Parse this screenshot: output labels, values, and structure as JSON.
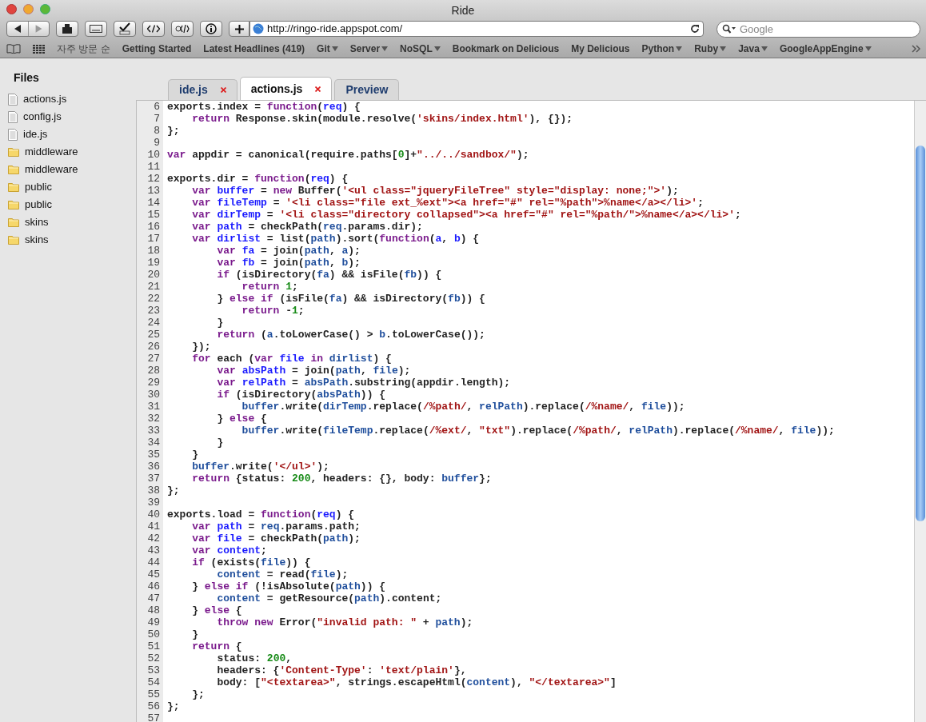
{
  "window": {
    "title": "Ride"
  },
  "toolbar": {
    "url": "http://ringo-ride.appspot.com/",
    "search": {
      "placeholder": "Google"
    }
  },
  "bookmarks": [
    {
      "label": "자주 방문 순",
      "menu": false
    },
    {
      "label": "Getting Started",
      "menu": false
    },
    {
      "label": "Latest Headlines (419)",
      "menu": false
    },
    {
      "label": "Git",
      "menu": true
    },
    {
      "label": "Server",
      "menu": true
    },
    {
      "label": "NoSQL",
      "menu": true
    },
    {
      "label": "Bookmark on Delicious",
      "menu": false
    },
    {
      "label": "My Delicious",
      "menu": false
    },
    {
      "label": "Python",
      "menu": true
    },
    {
      "label": "Ruby",
      "menu": true
    },
    {
      "label": "Java",
      "menu": true
    },
    {
      "label": "GoogleAppEngine",
      "menu": true
    }
  ],
  "sidebar": {
    "title": "Files",
    "items": [
      {
        "label": "actions.js",
        "kind": "file"
      },
      {
        "label": "config.js",
        "kind": "file"
      },
      {
        "label": "ide.js",
        "kind": "file"
      },
      {
        "label": "middleware",
        "kind": "folder"
      },
      {
        "label": "middleware",
        "kind": "folder"
      },
      {
        "label": "public",
        "kind": "folder"
      },
      {
        "label": "public",
        "kind": "folder"
      },
      {
        "label": "skins",
        "kind": "folder"
      },
      {
        "label": "skins",
        "kind": "folder"
      }
    ]
  },
  "tabs": [
    {
      "label": "ide.js",
      "closable": true,
      "selected": false
    },
    {
      "label": "actions.js",
      "closable": true,
      "selected": true
    },
    {
      "label": "Preview",
      "closable": false,
      "selected": false
    }
  ],
  "editor": {
    "lines": [
      {
        "n": "6",
        "tokens": [
          {
            "kind": "p",
            "text": "exports.index = "
          },
          {
            "kind": "k",
            "text": "function"
          },
          {
            "kind": "p",
            "text": "("
          },
          {
            "kind": "d",
            "text": "req"
          },
          {
            "kind": "p",
            "text": ") {"
          }
        ]
      },
      {
        "n": "7",
        "tokens": [
          {
            "kind": "k",
            "text": "    return"
          },
          {
            "kind": "p",
            "text": " Response.skin(module.resolve("
          },
          {
            "kind": "s",
            "text": "'skins/index.html'"
          },
          {
            "kind": "p",
            "text": "), {});"
          }
        ]
      },
      {
        "n": "8",
        "tokens": [
          {
            "kind": "p",
            "text": "};"
          }
        ]
      },
      {
        "n": "9"
      },
      {
        "n": "10",
        "tokens": [
          {
            "kind": "k",
            "text": "var"
          },
          {
            "kind": "p",
            "text": " appdir = canonical(require.paths["
          },
          {
            "kind": "n",
            "text": "0"
          },
          {
            "kind": "p",
            "text": "]+"
          },
          {
            "kind": "s",
            "text": "\"../../sandbox/\""
          },
          {
            "kind": "p",
            "text": ");"
          }
        ]
      },
      {
        "n": "11"
      },
      {
        "n": "12",
        "tokens": [
          {
            "kind": "p",
            "text": "exports.dir = "
          },
          {
            "kind": "k",
            "text": "function"
          },
          {
            "kind": "p",
            "text": "("
          },
          {
            "kind": "d",
            "text": "req"
          },
          {
            "kind": "p",
            "text": ") {"
          }
        ]
      },
      {
        "n": "13",
        "tokens": [
          {
            "kind": "k",
            "text": "    var"
          },
          {
            "kind": "d",
            "text": " buffer"
          },
          {
            "kind": "p",
            "text": " = "
          },
          {
            "kind": "k",
            "text": "new"
          },
          {
            "kind": "p",
            "text": " Buffer("
          },
          {
            "kind": "s",
            "text": "'<ul class=\"jqueryFileTree\" style=\"display: none;\">'"
          },
          {
            "kind": "p",
            "text": ");"
          }
        ]
      },
      {
        "n": "14",
        "tokens": [
          {
            "kind": "k",
            "text": "    var"
          },
          {
            "kind": "d",
            "text": " fileTemp"
          },
          {
            "kind": "p",
            "text": " = "
          },
          {
            "kind": "s",
            "text": "'<li class=\"file ext_%ext\"><a href=\"#\" rel=\"%path\">%name</a></li>'"
          },
          {
            "kind": "p",
            "text": ";"
          }
        ]
      },
      {
        "n": "15",
        "tokens": [
          {
            "kind": "k",
            "text": "    var"
          },
          {
            "kind": "d",
            "text": " dirTemp"
          },
          {
            "kind": "p",
            "text": " = "
          },
          {
            "kind": "s",
            "text": "'<li class=\"directory collapsed\"><a href=\"#\" rel=\"%path/\">%name</a></li>'"
          },
          {
            "kind": "p",
            "text": ";"
          }
        ]
      },
      {
        "n": "16",
        "tokens": [
          {
            "kind": "k",
            "text": "    var"
          },
          {
            "kind": "d",
            "text": " path"
          },
          {
            "kind": "p",
            "text": " = checkPath("
          },
          {
            "kind": "v",
            "text": "req"
          },
          {
            "kind": "p",
            "text": ".params.dir);"
          }
        ]
      },
      {
        "n": "17",
        "tokens": [
          {
            "kind": "k",
            "text": "    var"
          },
          {
            "kind": "d",
            "text": " dirlist"
          },
          {
            "kind": "p",
            "text": " = list("
          },
          {
            "kind": "v",
            "text": "path"
          },
          {
            "kind": "p",
            "text": ").sort("
          },
          {
            "kind": "k",
            "text": "function"
          },
          {
            "kind": "p",
            "text": "("
          },
          {
            "kind": "d",
            "text": "a"
          },
          {
            "kind": "p",
            "text": ", "
          },
          {
            "kind": "d",
            "text": "b"
          },
          {
            "kind": "p",
            "text": ") {"
          }
        ]
      },
      {
        "n": "18",
        "tokens": [
          {
            "kind": "k",
            "text": "        var"
          },
          {
            "kind": "d",
            "text": " fa"
          },
          {
            "kind": "p",
            "text": " = join("
          },
          {
            "kind": "v",
            "text": "path"
          },
          {
            "kind": "p",
            "text": ", "
          },
          {
            "kind": "v",
            "text": "a"
          },
          {
            "kind": "p",
            "text": ");"
          }
        ]
      },
      {
        "n": "19",
        "tokens": [
          {
            "kind": "k",
            "text": "        var"
          },
          {
            "kind": "d",
            "text": " fb"
          },
          {
            "kind": "p",
            "text": " = join("
          },
          {
            "kind": "v",
            "text": "path"
          },
          {
            "kind": "p",
            "text": ", "
          },
          {
            "kind": "v",
            "text": "b"
          },
          {
            "kind": "p",
            "text": ");"
          }
        ]
      },
      {
        "n": "20",
        "tokens": [
          {
            "kind": "k",
            "text": "        if"
          },
          {
            "kind": "p",
            "text": " (isDirectory("
          },
          {
            "kind": "v",
            "text": "fa"
          },
          {
            "kind": "p",
            "text": ") && isFile("
          },
          {
            "kind": "v",
            "text": "fb"
          },
          {
            "kind": "p",
            "text": ")) {"
          }
        ]
      },
      {
        "n": "21",
        "tokens": [
          {
            "kind": "k",
            "text": "            return"
          },
          {
            "kind": "n",
            "text": " 1"
          },
          {
            "kind": "p",
            "text": ";"
          }
        ]
      },
      {
        "n": "22",
        "tokens": [
          {
            "kind": "p",
            "text": "        } "
          },
          {
            "kind": "k",
            "text": "else if"
          },
          {
            "kind": "p",
            "text": " (isFile("
          },
          {
            "kind": "v",
            "text": "fa"
          },
          {
            "kind": "p",
            "text": ") && isDirectory("
          },
          {
            "kind": "v",
            "text": "fb"
          },
          {
            "kind": "p",
            "text": ")) {"
          }
        ]
      },
      {
        "n": "23",
        "tokens": [
          {
            "kind": "k",
            "text": "            return"
          },
          {
            "kind": "p",
            "text": " -"
          },
          {
            "kind": "n",
            "text": "1"
          },
          {
            "kind": "p",
            "text": ";"
          }
        ]
      },
      {
        "n": "24",
        "tokens": [
          {
            "kind": "p",
            "text": "        }"
          }
        ]
      },
      {
        "n": "25",
        "tokens": [
          {
            "kind": "k",
            "text": "        return"
          },
          {
            "kind": "p",
            "text": " ("
          },
          {
            "kind": "v",
            "text": "a"
          },
          {
            "kind": "p",
            "text": ".toLowerCase() > "
          },
          {
            "kind": "v",
            "text": "b"
          },
          {
            "kind": "p",
            "text": ".toLowerCase());"
          }
        ]
      },
      {
        "n": "26",
        "tokens": [
          {
            "kind": "p",
            "text": "    });"
          }
        ]
      },
      {
        "n": "27",
        "tokens": [
          {
            "kind": "k",
            "text": "    for"
          },
          {
            "kind": "p",
            "text": " each ("
          },
          {
            "kind": "k",
            "text": "var"
          },
          {
            "kind": "d",
            "text": " file"
          },
          {
            "kind": "k",
            "text": " in"
          },
          {
            "kind": "v",
            "text": " dirlist"
          },
          {
            "kind": "p",
            "text": ") {"
          }
        ]
      },
      {
        "n": "28",
        "tokens": [
          {
            "kind": "k",
            "text": "        var"
          },
          {
            "kind": "d",
            "text": " absPath"
          },
          {
            "kind": "p",
            "text": " = join("
          },
          {
            "kind": "v",
            "text": "path"
          },
          {
            "kind": "p",
            "text": ", "
          },
          {
            "kind": "v",
            "text": "file"
          },
          {
            "kind": "p",
            "text": ");"
          }
        ]
      },
      {
        "n": "29",
        "tokens": [
          {
            "kind": "k",
            "text": "        var"
          },
          {
            "kind": "d",
            "text": " relPath"
          },
          {
            "kind": "p",
            "text": " = "
          },
          {
            "kind": "v",
            "text": "absPath"
          },
          {
            "kind": "p",
            "text": ".substring(appdir.length);"
          }
        ]
      },
      {
        "n": "30",
        "tokens": [
          {
            "kind": "k",
            "text": "        if"
          },
          {
            "kind": "p",
            "text": " (isDirectory("
          },
          {
            "kind": "v",
            "text": "absPath"
          },
          {
            "kind": "p",
            "text": ")) {"
          }
        ]
      },
      {
        "n": "31",
        "tokens": [
          {
            "kind": "v",
            "text": "            buffer"
          },
          {
            "kind": "p",
            "text": ".write("
          },
          {
            "kind": "v",
            "text": "dirTemp"
          },
          {
            "kind": "p",
            "text": ".replace("
          },
          {
            "kind": "s",
            "text": "/%path/"
          },
          {
            "kind": "p",
            "text": ", "
          },
          {
            "kind": "v",
            "text": "relPath"
          },
          {
            "kind": "p",
            "text": ").replace("
          },
          {
            "kind": "s",
            "text": "/%name/"
          },
          {
            "kind": "p",
            "text": ", "
          },
          {
            "kind": "v",
            "text": "file"
          },
          {
            "kind": "p",
            "text": "));"
          }
        ]
      },
      {
        "n": "32",
        "tokens": [
          {
            "kind": "p",
            "text": "        } "
          },
          {
            "kind": "k",
            "text": "else"
          },
          {
            "kind": "p",
            "text": " {"
          }
        ]
      },
      {
        "n": "33",
        "tokens": [
          {
            "kind": "v",
            "text": "            buffer"
          },
          {
            "kind": "p",
            "text": ".write("
          },
          {
            "kind": "v",
            "text": "fileTemp"
          },
          {
            "kind": "p",
            "text": ".replace("
          },
          {
            "kind": "s",
            "text": "/%ext/"
          },
          {
            "kind": "p",
            "text": ", "
          },
          {
            "kind": "s",
            "text": "\"txt\""
          },
          {
            "kind": "p",
            "text": ").replace("
          },
          {
            "kind": "s",
            "text": "/%path/"
          },
          {
            "kind": "p",
            "text": ", "
          },
          {
            "kind": "v",
            "text": "relPath"
          },
          {
            "kind": "p",
            "text": ").replace("
          },
          {
            "kind": "s",
            "text": "/%name/"
          },
          {
            "kind": "p",
            "text": ", "
          },
          {
            "kind": "v",
            "text": "file"
          },
          {
            "kind": "p",
            "text": "));"
          }
        ]
      },
      {
        "n": "34",
        "tokens": [
          {
            "kind": "p",
            "text": "        }"
          }
        ]
      },
      {
        "n": "35",
        "tokens": [
          {
            "kind": "p",
            "text": "    }"
          }
        ]
      },
      {
        "n": "36",
        "tokens": [
          {
            "kind": "v",
            "text": "    buffer"
          },
          {
            "kind": "p",
            "text": ".write("
          },
          {
            "kind": "s",
            "text": "'</ul>'"
          },
          {
            "kind": "p",
            "text": ");"
          }
        ]
      },
      {
        "n": "37",
        "tokens": [
          {
            "kind": "k",
            "text": "    return"
          },
          {
            "kind": "p",
            "text": " {status: "
          },
          {
            "kind": "n",
            "text": "200"
          },
          {
            "kind": "p",
            "text": ", headers: {}, body: "
          },
          {
            "kind": "v",
            "text": "buffer"
          },
          {
            "kind": "p",
            "text": "};"
          }
        ]
      },
      {
        "n": "38",
        "tokens": [
          {
            "kind": "p",
            "text": "};"
          }
        ]
      },
      {
        "n": "39"
      },
      {
        "n": "40",
        "tokens": [
          {
            "kind": "p",
            "text": "exports.load = "
          },
          {
            "kind": "k",
            "text": "function"
          },
          {
            "kind": "p",
            "text": "("
          },
          {
            "kind": "d",
            "text": "req"
          },
          {
            "kind": "p",
            "text": ") {"
          }
        ]
      },
      {
        "n": "41",
        "tokens": [
          {
            "kind": "k",
            "text": "    var"
          },
          {
            "kind": "d",
            "text": " path"
          },
          {
            "kind": "p",
            "text": " = "
          },
          {
            "kind": "v",
            "text": "req"
          },
          {
            "kind": "p",
            "text": ".params.path;"
          }
        ]
      },
      {
        "n": "42",
        "tokens": [
          {
            "kind": "k",
            "text": "    var"
          },
          {
            "kind": "d",
            "text": " file"
          },
          {
            "kind": "p",
            "text": " = checkPath("
          },
          {
            "kind": "v",
            "text": "path"
          },
          {
            "kind": "p",
            "text": ");"
          }
        ]
      },
      {
        "n": "43",
        "tokens": [
          {
            "kind": "k",
            "text": "    var"
          },
          {
            "kind": "d",
            "text": " content"
          },
          {
            "kind": "p",
            "text": ";"
          }
        ]
      },
      {
        "n": "44",
        "tokens": [
          {
            "kind": "k",
            "text": "    if"
          },
          {
            "kind": "p",
            "text": " (exists("
          },
          {
            "kind": "v",
            "text": "file"
          },
          {
            "kind": "p",
            "text": ")) {"
          }
        ]
      },
      {
        "n": "45",
        "tokens": [
          {
            "kind": "v",
            "text": "        content"
          },
          {
            "kind": "p",
            "text": " = read("
          },
          {
            "kind": "v",
            "text": "file"
          },
          {
            "kind": "p",
            "text": ");"
          }
        ]
      },
      {
        "n": "46",
        "tokens": [
          {
            "kind": "p",
            "text": "    } "
          },
          {
            "kind": "k",
            "text": "else if"
          },
          {
            "kind": "p",
            "text": " (!isAbsolute("
          },
          {
            "kind": "v",
            "text": "path"
          },
          {
            "kind": "p",
            "text": ")) {"
          }
        ]
      },
      {
        "n": "47",
        "tokens": [
          {
            "kind": "v",
            "text": "        content"
          },
          {
            "kind": "p",
            "text": " = getResource("
          },
          {
            "kind": "v",
            "text": "path"
          },
          {
            "kind": "p",
            "text": ").content;"
          }
        ]
      },
      {
        "n": "48",
        "tokens": [
          {
            "kind": "p",
            "text": "    } "
          },
          {
            "kind": "k",
            "text": "else"
          },
          {
            "kind": "p",
            "text": " {"
          }
        ]
      },
      {
        "n": "49",
        "tokens": [
          {
            "kind": "k",
            "text": "        throw new"
          },
          {
            "kind": "p",
            "text": " Error("
          },
          {
            "kind": "s",
            "text": "\"invalid path: \""
          },
          {
            "kind": "p",
            "text": " + "
          },
          {
            "kind": "v",
            "text": "path"
          },
          {
            "kind": "p",
            "text": ");"
          }
        ]
      },
      {
        "n": "50",
        "tokens": [
          {
            "kind": "p",
            "text": "    }"
          }
        ]
      },
      {
        "n": "51",
        "tokens": [
          {
            "kind": "k",
            "text": "    return"
          },
          {
            "kind": "p",
            "text": " {"
          }
        ]
      },
      {
        "n": "52",
        "tokens": [
          {
            "kind": "p",
            "text": "        status: "
          },
          {
            "kind": "n",
            "text": "200"
          },
          {
            "kind": "p",
            "text": ","
          }
        ]
      },
      {
        "n": "53",
        "tokens": [
          {
            "kind": "p",
            "text": "        headers: {"
          },
          {
            "kind": "s",
            "text": "'Content-Type'"
          },
          {
            "kind": "p",
            "text": ": "
          },
          {
            "kind": "s",
            "text": "'text/plain'"
          },
          {
            "kind": "p",
            "text": "},"
          }
        ]
      },
      {
        "n": "54",
        "tokens": [
          {
            "kind": "p",
            "text": "        body: ["
          },
          {
            "kind": "s",
            "text": "\"<textarea>\""
          },
          {
            "kind": "p",
            "text": ", strings.escapeHtml("
          },
          {
            "kind": "v",
            "text": "content"
          },
          {
            "kind": "p",
            "text": "), "
          },
          {
            "kind": "s",
            "text": "\"</textarea>\""
          },
          {
            "kind": "p",
            "text": "]"
          }
        ]
      },
      {
        "n": "55",
        "tokens": [
          {
            "kind": "p",
            "text": "    };"
          }
        ]
      },
      {
        "n": "56",
        "tokens": [
          {
            "kind": "p",
            "text": "};"
          }
        ]
      },
      {
        "n": "57"
      }
    ]
  }
}
